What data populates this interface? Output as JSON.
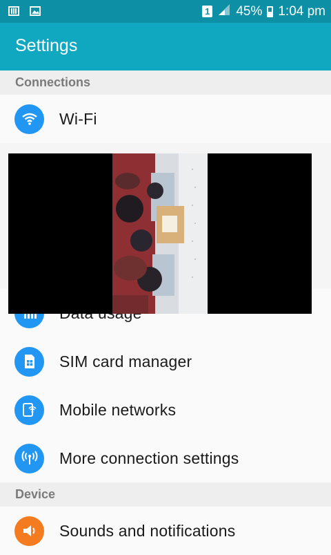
{
  "status_bar": {
    "left_icons": [
      "sim-storage-icon",
      "gallery-icon"
    ],
    "sim_slot": "1",
    "signal_icon": "signal-icon",
    "battery_percent": "45%",
    "battery_level": 0.45,
    "time": "1:04 pm",
    "color": "#0d8fa6"
  },
  "header": {
    "title": "Settings",
    "color": "#10a7c1"
  },
  "sections": {
    "connections": {
      "title": "Connections",
      "items": [
        {
          "label": "Wi-Fi",
          "icon": "wifi-icon"
        },
        {
          "label": "Data usage",
          "icon": "data-usage-icon"
        },
        {
          "label": "SIM card manager",
          "icon": "sim-card-icon"
        },
        {
          "label": "Mobile networks",
          "icon": "mobile-networks-icon"
        },
        {
          "label": "More connection settings",
          "icon": "more-connection-icon"
        }
      ]
    },
    "device": {
      "title": "Device",
      "items": [
        {
          "label": "Sounds and notifications",
          "icon": "sound-icon"
        }
      ]
    }
  },
  "overlay": {
    "type": "photo",
    "subject": "classroom-audience-photo"
  },
  "colors": {
    "accent_blue": "#2196f3",
    "accent_orange": "#f47b20"
  }
}
